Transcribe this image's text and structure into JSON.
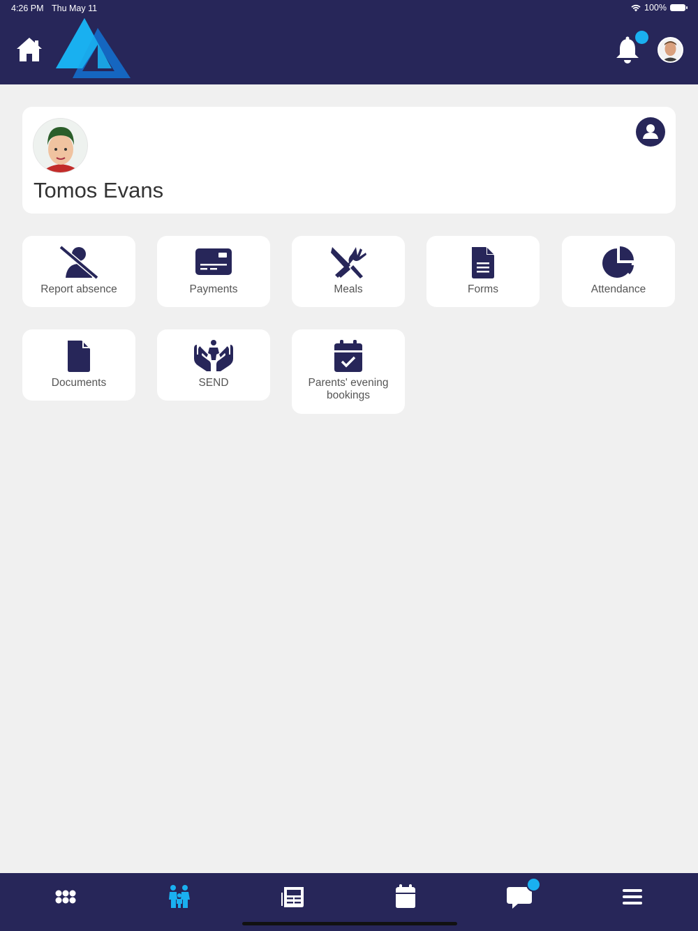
{
  "status_bar": {
    "time": "4:26 PM",
    "date": "Thu May 11",
    "battery": "100%"
  },
  "header": {
    "home_icon": "home-icon",
    "logo": "triangle-logo",
    "bell_icon": "bell-icon"
  },
  "child": {
    "name": "Tomos Evans"
  },
  "tiles": [
    {
      "label": "Report absence",
      "icon": "user-slash-icon"
    },
    {
      "label": "Payments",
      "icon": "credit-card-icon"
    },
    {
      "label": "Meals",
      "icon": "utensils-icon"
    },
    {
      "label": "Forms",
      "icon": "document-lines-icon"
    },
    {
      "label": "Attendance",
      "icon": "pie-chart-icon"
    },
    {
      "label": "Documents",
      "icon": "file-icon"
    },
    {
      "label": "SEND",
      "icon": "hands-child-icon"
    },
    {
      "label": "Parents' evening bookings",
      "icon": "calendar-check-icon"
    }
  ],
  "bottom_nav": [
    {
      "icon": "apps-grid-icon"
    },
    {
      "icon": "family-icon",
      "active": true
    },
    {
      "icon": "newspaper-icon"
    },
    {
      "icon": "calendar-icon"
    },
    {
      "icon": "chat-icon"
    },
    {
      "icon": "menu-icon"
    }
  ],
  "colors": {
    "primary": "#272659",
    "accent": "#1ab0f0",
    "background": "#f0f0f0"
  }
}
